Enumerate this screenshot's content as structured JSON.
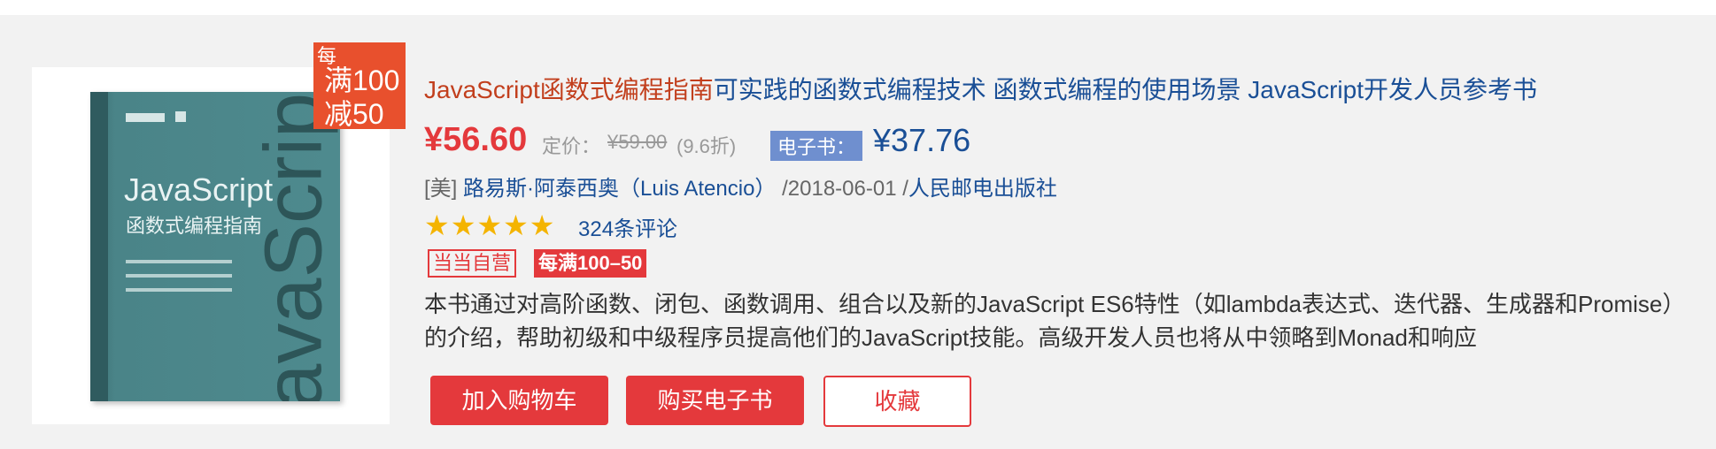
{
  "product": {
    "cover": {
      "book_title": "JavaScript",
      "book_subtitle": "函数式编程指南",
      "vertical_text": "JavaScript"
    },
    "promo_tag": {
      "top": "每",
      "line1": "满100",
      "line2": "减50"
    },
    "title_main": "JavaScript函数式编程指南",
    "title_desc": "可实践的函数式编程技术 函数式编程的使用场景 JavaScript开发人员参考书",
    "price": "¥56.60",
    "list_price_label": "定价：",
    "list_price": "¥59.00",
    "discount": "(9.6折)",
    "ebook_label": "电子书：",
    "ebook_price": "¥37.76",
    "author_prefix": "[美] ",
    "author": "路易斯·阿泰西奥（Luis Atencio）",
    "date": " /2018-06-01 /",
    "publisher": "人民邮电出版社",
    "rating_stars": 5,
    "reviews": "324条评论",
    "badge_self": "当当自营",
    "badge_promo": "每满100–50",
    "description": "本书通过对高阶函数、闭包、函数调用、组合以及新的JavaScript ES6特性（如lambda表达式、迭代器、生成器和Promise）的介绍，帮助初级和中级程序员提高他们的JavaScript技能。高级开发人员也将从中领略到Monad和响应",
    "buttons": {
      "cart": "加入购物车",
      "buy_ebook": "购买电子书",
      "favorite": "收藏"
    }
  },
  "colors": {
    "price_red": "#e4393c",
    "link_blue": "#1a4f96",
    "title_red": "#c23f1d",
    "promo_orange": "#e8502d",
    "ebook_badge": "#6f8fcf",
    "star_gold": "#f4b400"
  }
}
